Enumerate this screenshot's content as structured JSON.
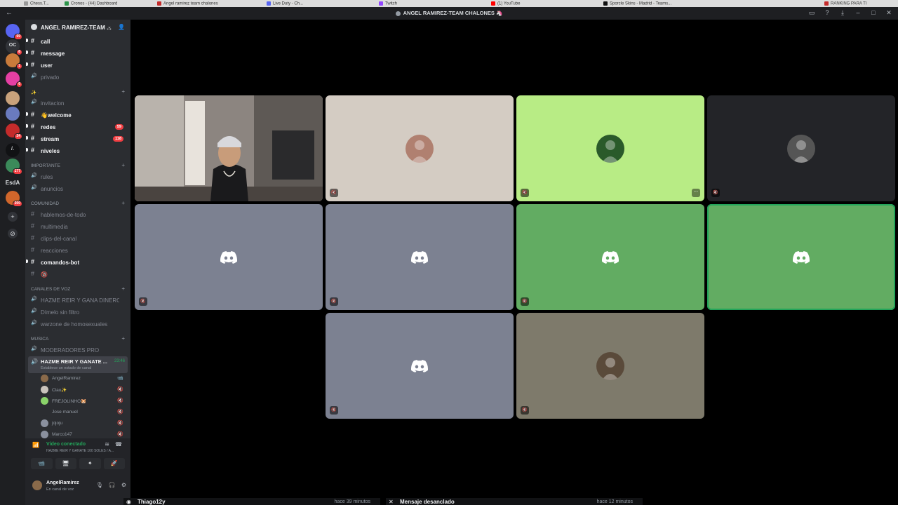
{
  "window": {
    "title": "ANGEL RAMIREZ-TEAM CHALONES",
    "title_suffix": "🦄"
  },
  "browser_tabs": [
    "Chess.T...",
    "Cronos - (44) Dashboard",
    "Angel ramirez team chalones",
    "Live Duty - Ch...",
    "Twitch",
    "(1) YouTube",
    "Sporcle Skins - Madrid - Teams...",
    "RANKING PARA TI"
  ],
  "rail": {
    "servers": [
      {
        "name": "discord-home",
        "badge": "69",
        "color": "#5865f2"
      },
      {
        "name": "server-oc",
        "badge": "8",
        "color": "#313338",
        "text": "OC"
      },
      {
        "name": "server-2",
        "badge": "1",
        "color": "#c97b3b"
      },
      {
        "name": "server-3",
        "badge": "6",
        "color": "#e53fa3"
      },
      {
        "name": "server-4",
        "badge": "",
        "color": "#c9a27b"
      },
      {
        "name": "server-5",
        "badge": "",
        "color": "#6a7bbf"
      },
      {
        "name": "server-6",
        "badge": "24",
        "color": "#c42b2b"
      },
      {
        "name": "server-7",
        "badge": "",
        "color": "#111214",
        "text": "/."
      },
      {
        "name": "server-8",
        "badge": "177",
        "color": "#3b8a5a"
      },
      {
        "name": "server-9",
        "badge": "300",
        "color": "#d0662b"
      }
    ],
    "label_esda": "EsdA",
    "add_icon": "+",
    "explore_icon": "⊘"
  },
  "guild": {
    "name": "ANGEL RAMIREZ-TEAM ...",
    "channels_top": [
      {
        "label": "call",
        "unread": true
      },
      {
        "label": "message",
        "unread": true
      },
      {
        "label": "user",
        "unread": true
      },
      {
        "label": "privado",
        "unread": false,
        "voice": true
      }
    ],
    "category_sparkle": "✨ ·",
    "channels_sparkle": [
      {
        "label": "invitacion",
        "unread": false,
        "voice": true
      },
      {
        "label": "👋welcome",
        "unread": true
      },
      {
        "label": "redes",
        "unread": true,
        "badge": "59"
      },
      {
        "label": "stream",
        "unread": true,
        "badge": "118"
      },
      {
        "label": "niveles",
        "unread": true
      }
    ],
    "category_importante": "IMPORTANTE",
    "channels_importante": [
      {
        "label": "rules",
        "unread": false,
        "voice": true
      },
      {
        "label": "anuncios",
        "unread": false,
        "voice": true
      }
    ],
    "category_comunidad": "COMUNIDAD",
    "channels_comunidad": [
      {
        "label": "hablemos-de-todo",
        "unread": false
      },
      {
        "label": "multimedia",
        "unread": false
      },
      {
        "label": "clips-del-canal",
        "unread": false
      },
      {
        "label": "reacciones",
        "unread": false
      },
      {
        "label": "comandos-bot",
        "unread": true
      },
      {
        "label": "🔞",
        "unread": false
      }
    ],
    "category_voz": "Canales de voz",
    "channels_voz": [
      {
        "label": "HAZME REIR Y GANA DINERO ..."
      },
      {
        "label": "Dímelo sin filtro"
      },
      {
        "label": "warzone de homosexuales"
      }
    ],
    "category_musica": "MUSICA",
    "channels_musica": [
      {
        "label": "MODERADORES PRO"
      }
    ],
    "active_voice": {
      "label": "HAZME REIR Y GANATE ...",
      "time": "23:46",
      "status": "Establece un estado de canal"
    },
    "voice_users": [
      {
        "name": "AngelRamirez",
        "icon": "📹",
        "color": "#8a6a4a"
      },
      {
        "name": "Clau✨",
        "icon": "🔇",
        "color": "#c9c3bc"
      },
      {
        "name": "FREJOLINHO🐹",
        "icon": "🔇",
        "color": "#8ad36a"
      },
      {
        "name": "Jose manuel",
        "icon": "🔇",
        "color": "#2b2d31"
      },
      {
        "name": "jojoju",
        "icon": "🔇",
        "color": "#8a909e"
      },
      {
        "name": "Marco147",
        "icon": "🔇",
        "color": "#8a909e"
      }
    ]
  },
  "rtc": {
    "title": "Vídeo conectado",
    "subtitle": "HAZME REIR Y GANATE 100 SOLES / A...",
    "buttons": [
      "📹",
      "🖥",
      "✦",
      "🚀"
    ]
  },
  "user": {
    "name": "AngelRamirez",
    "status": "En canal de voz"
  },
  "tiles": [
    {
      "kind": "camera",
      "bg": "#7a7470",
      "muted": false
    },
    {
      "kind": "avatar",
      "bg": "#d4ccc3",
      "muted": true,
      "avatar_color": "#b08070"
    },
    {
      "kind": "avatar",
      "bg": "#b8ec85",
      "muted": true,
      "avatar_color": "#2a5a2a",
      "more": true
    },
    {
      "kind": "avatar",
      "bg": "#232428",
      "muted": true,
      "avatar_color": "#555"
    },
    {
      "kind": "logo",
      "bg": "#7c8191",
      "muted": true
    },
    {
      "kind": "logo",
      "bg": "#7c8191",
      "muted": true
    },
    {
      "kind": "logo",
      "bg": "#62ac62",
      "muted": true
    },
    {
      "kind": "logo",
      "bg": "#62ac62",
      "muted": false,
      "speaking": true
    },
    {
      "kind": "logo",
      "bg": "#7c8191",
      "muted": true
    },
    {
      "kind": "avatar",
      "bg": "#7e7a6b",
      "muted": true,
      "avatar_color": "#5a4a3a"
    }
  ],
  "notifications": [
    {
      "title": "Thiago12y",
      "time": "hace 39 minutos",
      "icon": "◉"
    },
    {
      "title": "Mensaje desanclado",
      "time": "hace 12 minutos",
      "icon": "✕"
    }
  ],
  "colors": {
    "discord_green": "#23a55a",
    "mention_red": "#f23f43",
    "blurple": "#5865f2"
  }
}
